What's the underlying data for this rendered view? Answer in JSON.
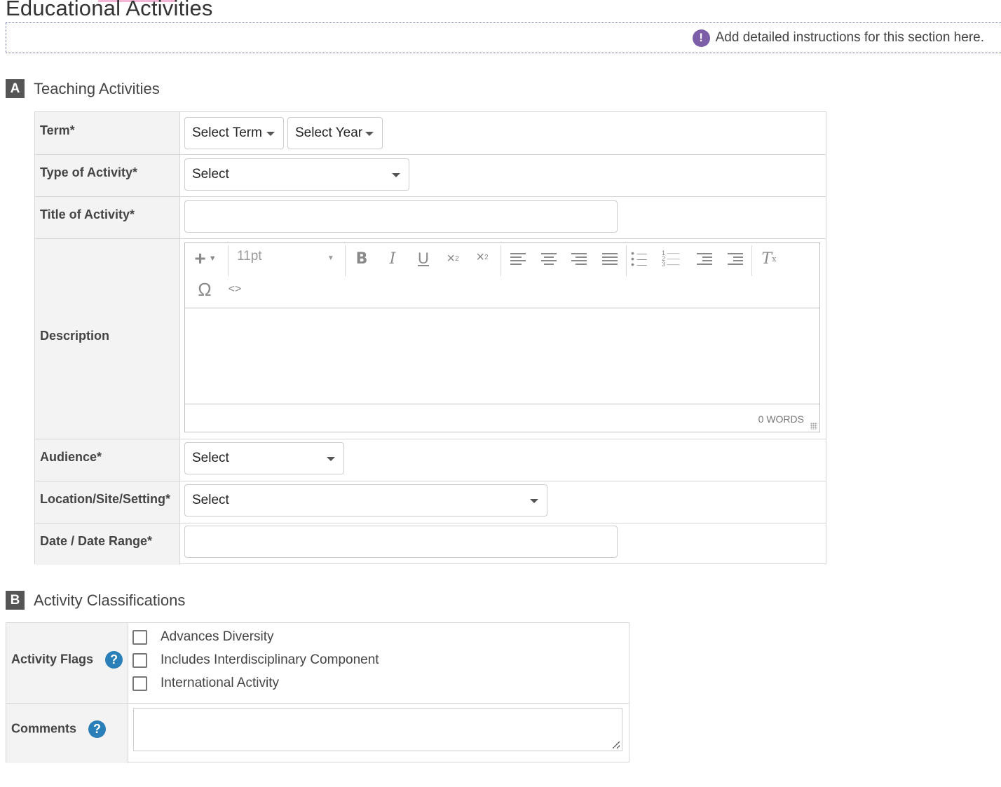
{
  "page": {
    "title": "Educational Activities",
    "instructions": "Add detailed instructions for this section here."
  },
  "section_a": {
    "letter": "A",
    "title": "Teaching Activities",
    "fields": {
      "term_label": "Term*",
      "term_select": "Select Term",
      "year_select": "Select Year",
      "type_label": "Type of Activity*",
      "type_select": "Select",
      "title_label": "Title of Activity*",
      "title_value": "",
      "description_label": "Description",
      "audience_label": "Audience*",
      "audience_select": "Select",
      "location_label": "Location/Site/Setting*",
      "location_select": "Select",
      "date_label": "Date / Date Range*",
      "date_value": ""
    },
    "editor": {
      "font_size": "11pt",
      "word_count": "0 WORDS",
      "toolbar_icons": [
        "insert-icon",
        "bold-icon",
        "italic-icon",
        "underline-icon",
        "subscript-icon",
        "superscript-icon",
        "align-left-icon",
        "align-center-icon",
        "align-right-icon",
        "justify-icon",
        "bullet-list-icon",
        "numbered-list-icon",
        "outdent-icon",
        "indent-icon",
        "clear-format-icon",
        "special-char-icon",
        "source-code-icon"
      ]
    }
  },
  "section_b": {
    "letter": "B",
    "title": "Activity Classifications",
    "flags_label": "Activity Flags",
    "flags": [
      {
        "label": "Advances Diversity",
        "checked": false
      },
      {
        "label": "Includes Interdisciplinary Component",
        "checked": false
      },
      {
        "label": "International Activity",
        "checked": false
      }
    ],
    "comments_label": "Comments",
    "comments_value": ""
  },
  "colors": {
    "info_icon": "#7b5ea7",
    "help_icon": "#2a7fb8",
    "section_letter_bg": "#555555",
    "label_bg": "#f3f3f3"
  }
}
